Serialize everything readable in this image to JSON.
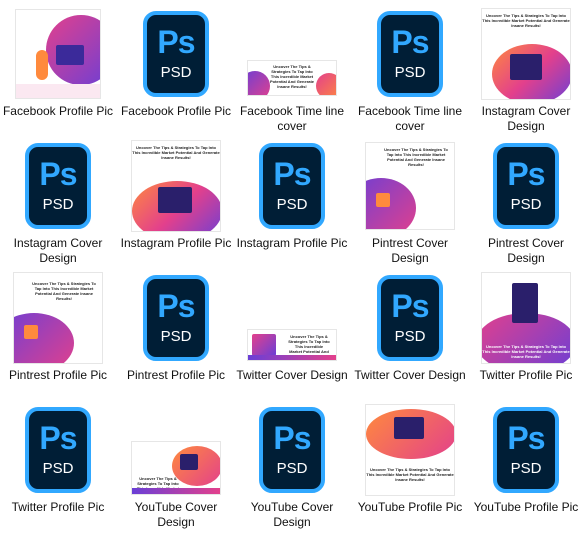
{
  "colors": {
    "ps_bg": "#001e36",
    "ps_blue": "#31a8ff",
    "purple": "#6a3fd6",
    "pink": "#e3408c",
    "orange": "#ff8a3d"
  },
  "psd_icon": {
    "logo": "Ps",
    "ext": "PSD"
  },
  "image_headline": "Uncover The Tips & Strategies To Tap Into This Incredible Market Potential And Generate Insane Results!",
  "items": [
    {
      "label": "Facebook Profile Pic",
      "kind": "image"
    },
    {
      "label": "Facebook Profile Pic",
      "kind": "psd"
    },
    {
      "label": "Facebook Time line cover",
      "kind": "image"
    },
    {
      "label": "Facebook Time line cover",
      "kind": "psd"
    },
    {
      "label": "Instagram Cover Design",
      "kind": "image"
    },
    {
      "label": "Instagram Cover Design",
      "kind": "psd"
    },
    {
      "label": "Instagram Profile Pic",
      "kind": "image"
    },
    {
      "label": "Instagram Profile Pic",
      "kind": "psd"
    },
    {
      "label": "Pintrest Cover Design",
      "kind": "image"
    },
    {
      "label": "Pintrest Cover Design",
      "kind": "psd"
    },
    {
      "label": "Pintrest Profile Pic",
      "kind": "image"
    },
    {
      "label": "Pintrest Profile Pic",
      "kind": "psd"
    },
    {
      "label": "Twitter Cover Design",
      "kind": "image"
    },
    {
      "label": "Twitter Cover Design",
      "kind": "psd"
    },
    {
      "label": "Twitter Profile Pic",
      "kind": "image"
    },
    {
      "label": "Twitter Profile Pic",
      "kind": "psd"
    },
    {
      "label": "YouTube Cover Design",
      "kind": "image"
    },
    {
      "label": "YouTube Cover Design",
      "kind": "psd"
    },
    {
      "label": "YouTube Profile Pic",
      "kind": "image"
    },
    {
      "label": "YouTube Profile Pic",
      "kind": "psd"
    }
  ]
}
